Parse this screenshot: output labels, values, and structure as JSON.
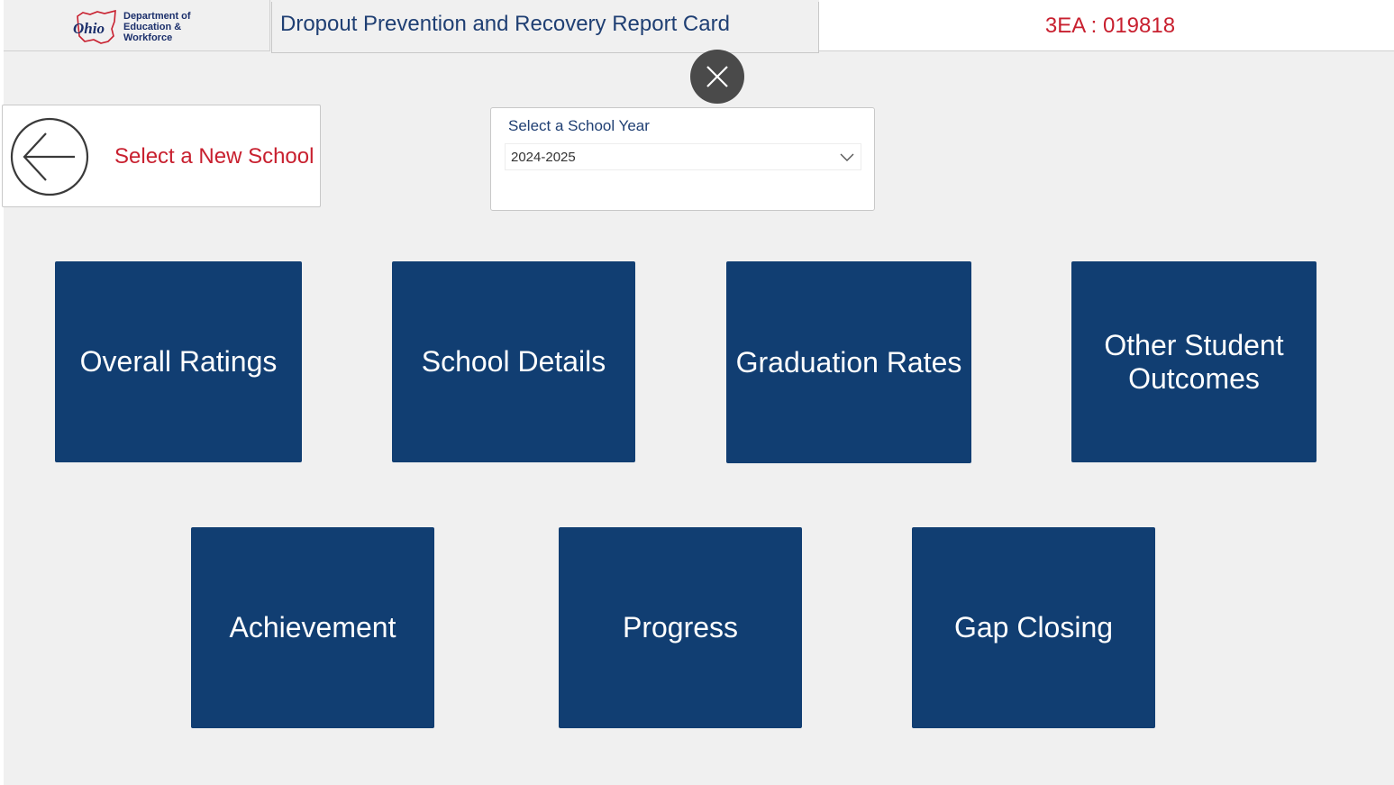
{
  "header": {
    "logo": {
      "lines": [
        "Department of",
        "Education &",
        "Workforce"
      ],
      "script_text": "Ohio",
      "icon": "ohio-state-logo"
    },
    "title": "Dropout Prevention and Recovery Report Card",
    "id_label": "3EA : 019818",
    "close_icon": "close-icon"
  },
  "back": {
    "label": "Select a New School",
    "icon": "arrow-left-circle-icon"
  },
  "filter": {
    "label": "Select a School Year",
    "selected": "2024-2025",
    "icon": "chevron-down-icon"
  },
  "tiles": {
    "overall": "Overall Ratings",
    "school": "School Details",
    "grad": "Graduation Rates",
    "other": "Other Student Outcomes",
    "ach": "Achievement",
    "prog": "Progress",
    "gap": "Gap Closing"
  },
  "colors": {
    "tile": "#113e72",
    "accent_red": "#c8202f",
    "title_blue": "#1f3f73",
    "canvas": "#f0f0f0"
  }
}
